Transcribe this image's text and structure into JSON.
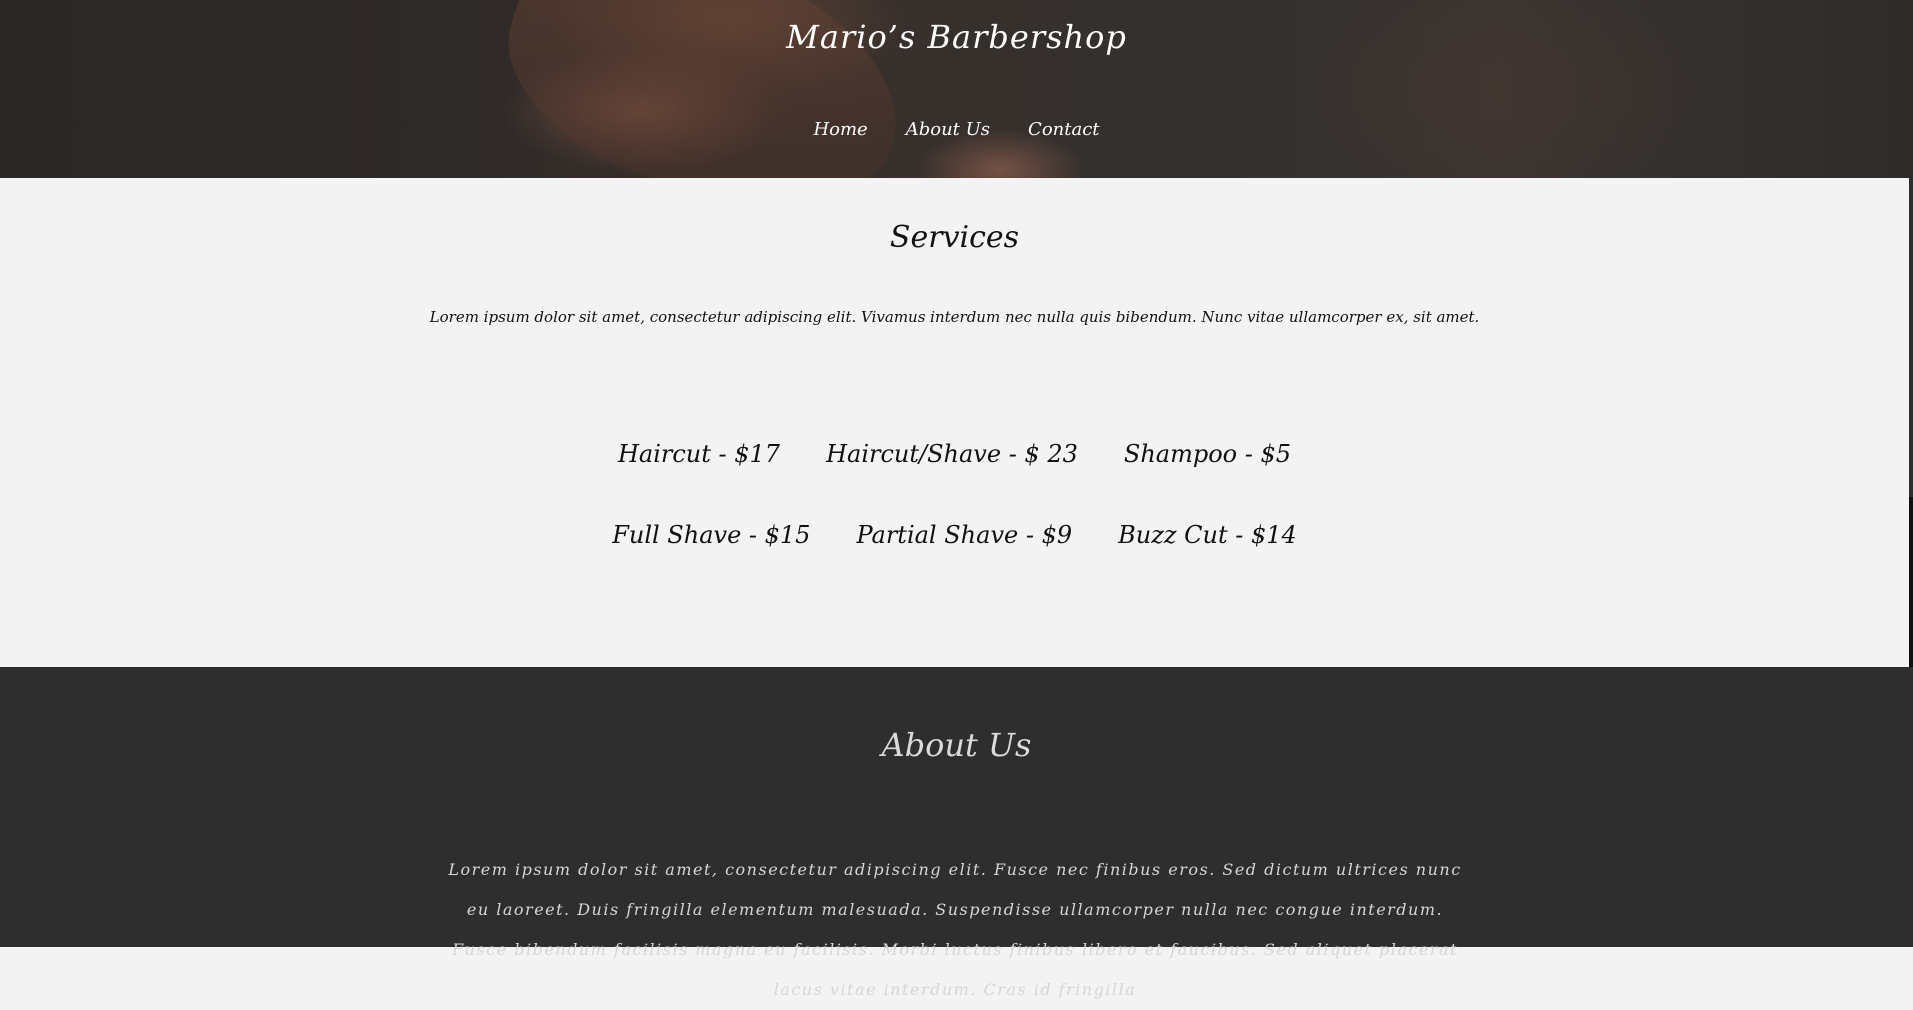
{
  "header": {
    "title": "Mario’s Barbershop",
    "nav": [
      "Home",
      "About Us",
      "Contact"
    ]
  },
  "services": {
    "heading": "Services",
    "intro": "Lorem ipsum dolor sit amet, consectetur adipiscing elit. Vivamus interdum nec nulla quis bibendum. Nunc vitae ullamcorper ex, sit amet.",
    "prices_row1": [
      "Haircut - $17",
      "Haircut/Shave - $ 23",
      "Shampoo - $5"
    ],
    "prices_row2": [
      "Full Shave - $15",
      "Partial Shave - $9",
      "Buzz Cut - $14"
    ]
  },
  "about": {
    "heading": "About Us",
    "text": "Lorem ipsum dolor sit amet, consectetur adipiscing elit. Fusce nec finibus eros. Sed dictum ultrices nunc eu laoreet. Duis fringilla elementum malesuada. Suspendisse ullamcorper nulla nec congue interdum. Fusce bibendum facilisis magna eu facilisis. Morbi luctus finibus libero et faucibus. Sed aliquet placerat lacus vitae interdum. Cras id fringilla"
  },
  "colors": {
    "hero_bg": "#2c2a29",
    "services_bg": "#f3f3f3",
    "about_bg": "#2e2e2e",
    "heading_light": "#dadada"
  }
}
